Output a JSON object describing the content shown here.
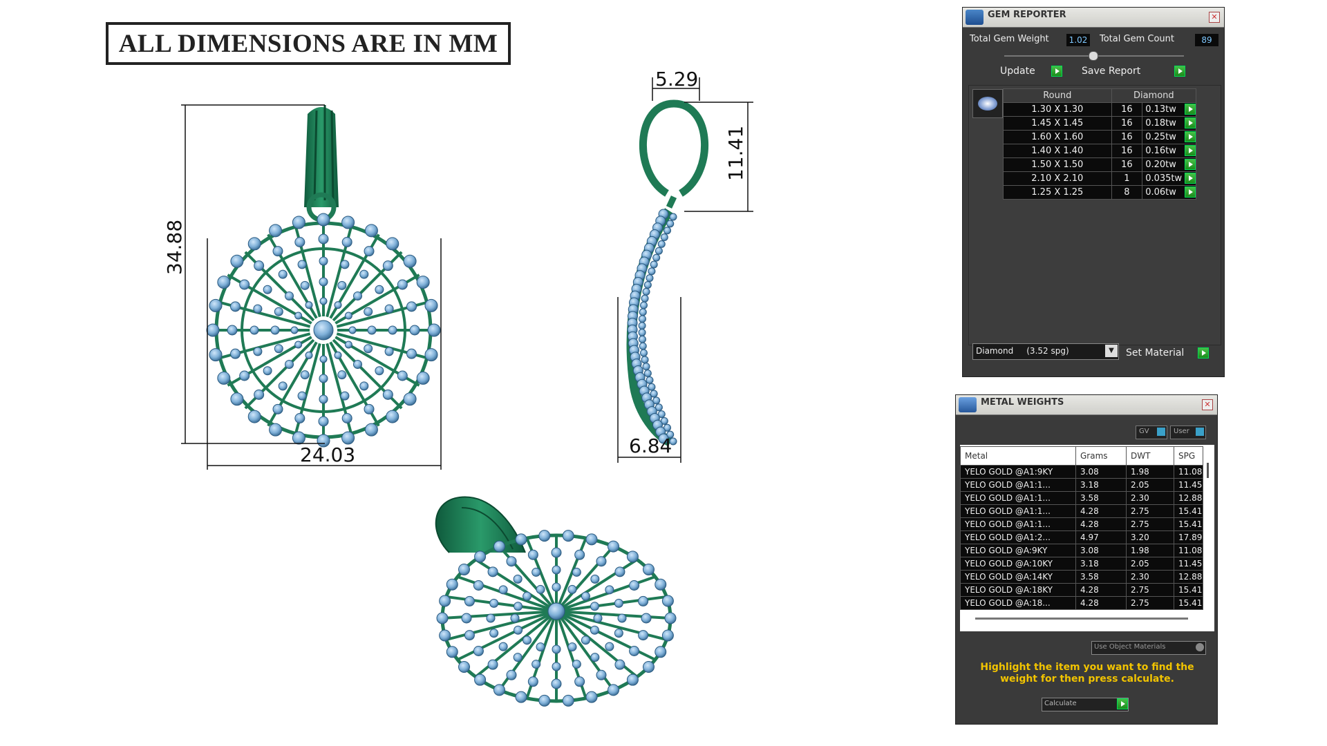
{
  "header": {
    "title": "ALL DIMENSIONS ARE IN MM"
  },
  "dimensions": {
    "front_height": "34.88",
    "front_width": "24.03",
    "side_top_width": "5.29",
    "side_bail_height": "11.41",
    "side_depth": "6.84"
  },
  "gem_reporter": {
    "title": "GEM REPORTER",
    "total_weight_label": "Total Gem Weight",
    "total_weight_value": "1.02",
    "total_count_label": "Total Gem Count",
    "total_count_value": "89",
    "update_label": "Update",
    "save_label": "Save Report",
    "col_shape": "Round",
    "col_type": "Diamond",
    "rows": [
      {
        "size": "1.30 X 1.30",
        "qty": "16",
        "wt": "0.13tw"
      },
      {
        "size": "1.45 X 1.45",
        "qty": "16",
        "wt": "0.18tw"
      },
      {
        "size": "1.60 X 1.60",
        "qty": "16",
        "wt": "0.25tw"
      },
      {
        "size": "1.40 X 1.40",
        "qty": "16",
        "wt": "0.16tw"
      },
      {
        "size": "1.50 X 1.50",
        "qty": "16",
        "wt": "0.20tw"
      },
      {
        "size": "2.10 X 2.10",
        "qty": "1",
        "wt": "0.035tw"
      },
      {
        "size": "1.25 X 1.25",
        "qty": "8",
        "wt": "0.06tw"
      }
    ],
    "material_select": "Diamond     (3.52 spg)",
    "set_material_label": "Set Material"
  },
  "metal_weights": {
    "title": "METAL WEIGHTS",
    "gv_label": "GV",
    "user_label": "User",
    "headers": [
      "Metal",
      "Grams",
      "DWT",
      "SPG"
    ],
    "rows": [
      [
        "YELO GOLD @A1:9KY",
        "3.08",
        "1.98",
        "11.08"
      ],
      [
        "YELO GOLD @A1:1...",
        "3.18",
        "2.05",
        "11.45"
      ],
      [
        "YELO GOLD @A1:1...",
        "3.58",
        "2.30",
        "12.88"
      ],
      [
        "YELO GOLD @A1:1...",
        "4.28",
        "2.75",
        "15.41"
      ],
      [
        "YELO GOLD @A1:1...",
        "4.28",
        "2.75",
        "15.41"
      ],
      [
        "YELO GOLD @A1:2...",
        "4.97",
        "3.20",
        "17.89"
      ],
      [
        "YELO GOLD @A:9KY",
        "3.08",
        "1.98",
        "11.08"
      ],
      [
        "YELO GOLD @A:10KY",
        "3.18",
        "2.05",
        "11.45"
      ],
      [
        "YELO GOLD @A:14KY",
        "3.58",
        "2.30",
        "12.88"
      ],
      [
        "YELO GOLD @A:18KY",
        "4.28",
        "2.75",
        "15.41"
      ],
      [
        "YELO GOLD @A:18...",
        "4.28",
        "2.75",
        "15.41"
      ]
    ],
    "use_object_label": "Use Object Materials",
    "hint": "Highlight the item you want to find the weight for then press calculate.",
    "calculate_label": "Calculate"
  },
  "colors": {
    "metal": "#1f7a55",
    "stone": "#7fb0d8",
    "panel": "#3a3a3a",
    "accent": "#f2c400"
  }
}
